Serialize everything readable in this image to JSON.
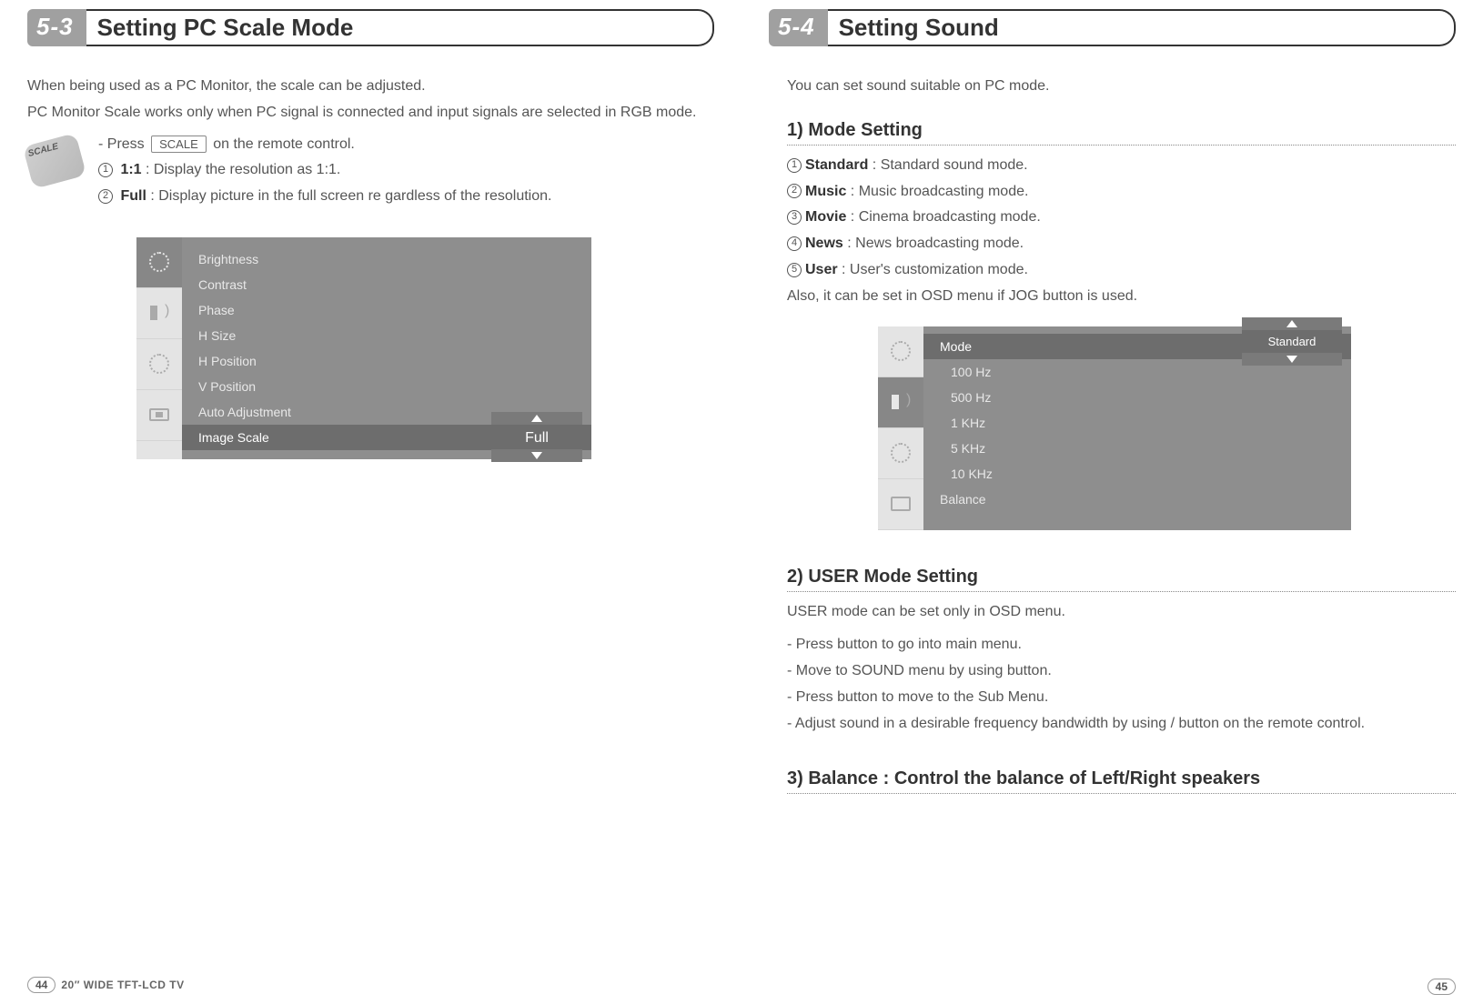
{
  "left": {
    "section_num": "5-3",
    "section_title": "Setting PC Scale Mode",
    "p1": "When being used as a PC Monitor, the scale can be adjusted.",
    "p2": "PC Monitor Scale works only when PC signal is connected and input signals are selected in RGB mode.",
    "press_prefix": "- Press",
    "scale_key": "SCALE",
    "press_suffix": "on the remote control.",
    "scale_btn_label": "SCALE",
    "opt1_label": "1:1",
    "opt1_desc": ": Display the resolution as 1:1.",
    "opt2_label": "Full",
    "opt2_desc": ": Display picture in the full screen re gardless of the resolution.",
    "osd": {
      "items": [
        "Brightness",
        "Contrast",
        "Phase",
        "H Size",
        "H Position",
        "V Position",
        "Auto Adjustment",
        "Image Scale"
      ],
      "value": "Full"
    },
    "footer_pagenum": "44",
    "footer_text": "20″ WIDE TFT-LCD TV"
  },
  "right": {
    "section_num": "5-4",
    "section_title": "Setting Sound",
    "intro": "You can set sound suitable on PC mode.",
    "sub1": "1) Mode Setting",
    "m1_label": "Standard",
    "m1_desc": ": Standard sound mode.",
    "m2_label": "Music",
    "m2_desc": ": Music broadcasting mode.",
    "m3_label": "Movie",
    "m3_desc": ": Cinema broadcasting mode.",
    "m4_label": "News",
    "m4_desc": ": News broadcasting mode.",
    "m5_label": "User",
    "m5_desc": ": User's customization mode.",
    "m_note": "Also, it can be set in OSD menu if JOG button is used.",
    "osd": {
      "mode_label": "Mode",
      "mode_value": "Standard",
      "items": [
        "100 Hz",
        "500 Hz",
        "1 KHz",
        "5 KHz",
        "10 KHz",
        "Balance"
      ]
    },
    "sub2": "2) USER Mode Setting",
    "u_intro": "USER mode can be set only in OSD menu.",
    "u_s1": "- Press button to go into main menu.",
    "u_s2": "- Move to SOUND menu by using button.",
    "u_s3": "- Press button to move to the Sub Menu.",
    "u_s4": "- Adjust sound in a desirable frequency bandwidth by using / button on the remote control.",
    "sub3": "3) Balance : Control the balance of Left/Right speakers",
    "footer_pagenum": "45"
  }
}
